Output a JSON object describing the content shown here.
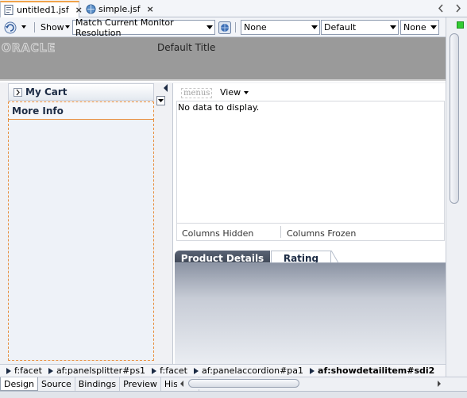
{
  "editor_tabs": [
    {
      "label": "untitled1.jsf",
      "active": true
    },
    {
      "label": "simple.jsf",
      "active": false
    }
  ],
  "toolbar": {
    "show_label": "Show",
    "resolution": "Match Current Monitor Resolution",
    "select1": "None",
    "select2": "Default",
    "select3": "None"
  },
  "brand": {
    "logo_text": "ORACLE",
    "title": "Default Title"
  },
  "accordion": {
    "items": [
      {
        "label": "My Cart"
      },
      {
        "label": "More Info"
      }
    ]
  },
  "content": {
    "menus_label": "menus",
    "view_menu": "View",
    "no_data": "No data to display.",
    "columns_hidden": "Columns Hidden",
    "columns_frozen": "Columns Frozen",
    "tabs": [
      {
        "label": "Product Details",
        "active": false
      },
      {
        "label": "Rating",
        "active": true
      }
    ]
  },
  "breadcrumb": [
    "f:facet",
    "af:panelsplitter#ps1",
    "f:facet",
    "af:panelaccordion#pa1",
    "af:showdetailitem#sdi2"
  ],
  "bottom_tabs": [
    {
      "label": "Design",
      "active": true
    },
    {
      "label": "Source",
      "active": false
    },
    {
      "label": "Bindings",
      "active": false
    },
    {
      "label": "Preview",
      "active": false
    },
    {
      "label": "History",
      "active": false
    }
  ],
  "colors": {
    "selection_outline": "#e88d3b",
    "brand_bar": "#9a9a9a",
    "status_green": "#33cc33"
  }
}
